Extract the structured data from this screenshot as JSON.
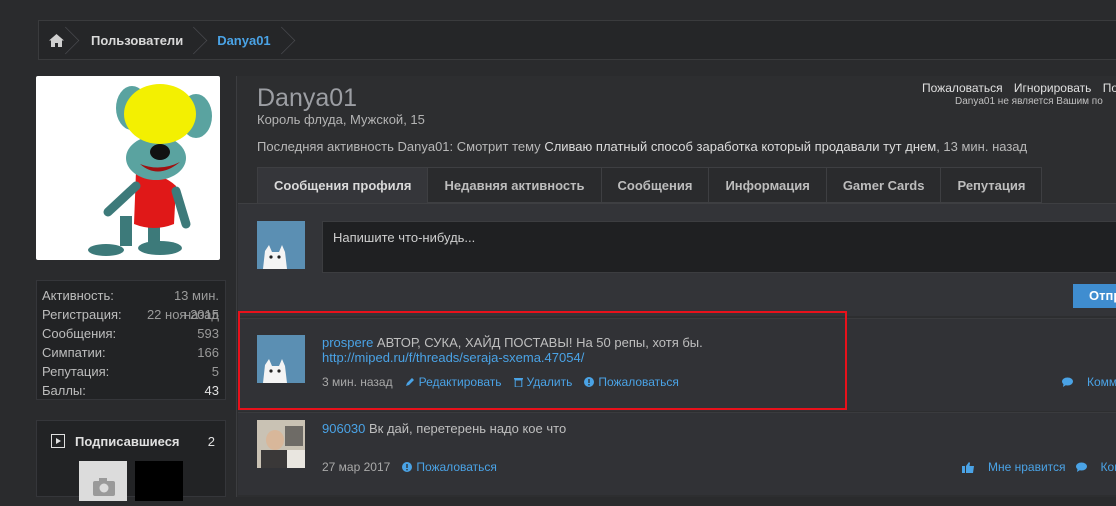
{
  "breadcrumb": {
    "items": [
      "Пользователи",
      "Danya01"
    ]
  },
  "profile": {
    "username": "Danya01",
    "title": "Король флуда, Мужской, 15",
    "last_activity_prefix": "Последняя активность Danya01:",
    "last_activity_action": "Смотрит тему",
    "last_activity_thread": "Сливаю платный способ заработка который продавали тут днем",
    "last_activity_time": ", 13 мин. назад"
  },
  "top_actions": {
    "report": "Пожаловаться",
    "ignore": "Игнорировать",
    "more": "Под",
    "note": "Danya01 не является Вашим по"
  },
  "stats": [
    {
      "label": "Активность:",
      "value": "13 мин. назад"
    },
    {
      "label": "Регистрация:",
      "value": "22 ноя 2015"
    },
    {
      "label": "Сообщения:",
      "value": "593"
    },
    {
      "label": "Симпатии:",
      "value": "166"
    },
    {
      "label": "Репутация:",
      "value": "5"
    },
    {
      "label": "Баллы:",
      "value": "43"
    }
  ],
  "subscribers": {
    "label": "Подписавшиеся",
    "count": "2"
  },
  "tabs": [
    "Сообщения профиля",
    "Недавняя активность",
    "Сообщения",
    "Информация",
    "Gamer Cards",
    "Репутация"
  ],
  "composer": {
    "placeholder": "Напишите что-нибудь...",
    "post_button": "Отпр"
  },
  "messages": [
    {
      "author": "prospere",
      "text": " АВТОР, СУКА, ХАЙД ПОСТАВЫ! На 50 репы, хотя бы.",
      "link": "http://miped.ru/f/threads/seraja-sxema.47054/",
      "time": "3 мин. назад",
      "edit": "Редактировать",
      "delete": "Удалить",
      "report": "Пожаловаться",
      "comment": "Комме"
    },
    {
      "author": "906030",
      "text": " Вк дай, перетерень надо кое что",
      "time": "27 мар 2017",
      "report": "Пожаловаться",
      "like": "Мне нравится",
      "comment": "Комме"
    }
  ],
  "colors": {
    "accent": "#4aa3e6",
    "highlight": "#e8111b",
    "background": "#2a2b2d",
    "button": "#3f8dd0"
  }
}
